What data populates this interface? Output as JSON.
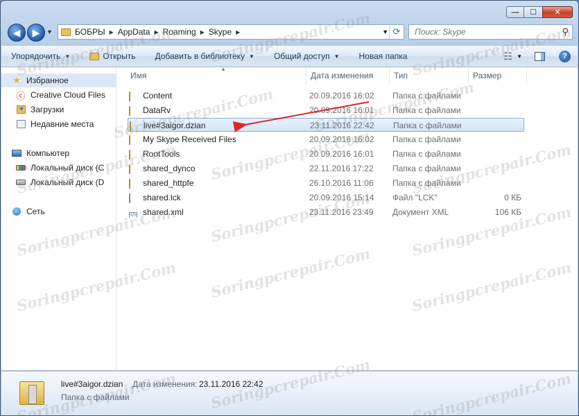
{
  "window": {
    "minimize_glyph": "—",
    "maximize_glyph": "☐",
    "close_glyph": "✕"
  },
  "address_bar": {
    "crumbs": [
      "БОБРЫ",
      "AppData",
      "Roaming",
      "Skype"
    ],
    "search_placeholder": "Поиск: Skype"
  },
  "toolbar": {
    "organize": "Упорядочить",
    "open": "Открыть",
    "add_to_library": "Добавить в библиотеку",
    "share": "Общий доступ",
    "new_folder": "Новая папка"
  },
  "nav_pane": {
    "favorites": "Избранное",
    "favorites_items": [
      "Creative Cloud Files",
      "Загрузки",
      "Недавние места"
    ],
    "computer": "Компьютер",
    "computer_items": [
      "Локальный диск (C",
      "Локальный диск (D"
    ],
    "network": "Сеть"
  },
  "columns": {
    "name": "Имя",
    "date": "Дата изменения",
    "type": "Тип",
    "size": "Размер"
  },
  "files": [
    {
      "name": "Content",
      "date": "20.09.2016 16:02",
      "type": "Папка с файлами",
      "size": "",
      "kind": "folder"
    },
    {
      "name": "DataRv",
      "date": "20.09.2016 16:01",
      "type": "Папка с файлами",
      "size": "",
      "kind": "folder"
    },
    {
      "name": "live#3aigor.dzian",
      "date": "23.11.2016 22:42",
      "type": "Папка с файлами",
      "size": "",
      "kind": "folder",
      "selected": true
    },
    {
      "name": "My Skype Received Files",
      "date": "20.09.2016 16:02",
      "type": "Папка с файлами",
      "size": "",
      "kind": "folder"
    },
    {
      "name": "RootTools",
      "date": "20.09.2016 16:01",
      "type": "Папка с файлами",
      "size": "",
      "kind": "folder"
    },
    {
      "name": "shared_dynco",
      "date": "22.11.2016 17:22",
      "type": "Папка с файлами",
      "size": "",
      "kind": "folder"
    },
    {
      "name": "shared_httpfe",
      "date": "26.10.2016 11:06",
      "type": "Папка с файлами",
      "size": "",
      "kind": "folder"
    },
    {
      "name": "shared.lck",
      "date": "20.09.2016 15:14",
      "type": "Файл \"LCK\"",
      "size": "0 КБ",
      "kind": "file"
    },
    {
      "name": "shared.xml",
      "date": "23.11.2016 23:49",
      "type": "Документ XML",
      "size": "106 КБ",
      "kind": "xml"
    }
  ],
  "details": {
    "name": "live#3aigor.dzian",
    "date_label": "Дата изменения:",
    "date_value": "23.11.2016 22:42",
    "type": "Папка с файлами"
  },
  "annotation_color": "#e0242a",
  "watermark": "Soringpcrepair.Com"
}
